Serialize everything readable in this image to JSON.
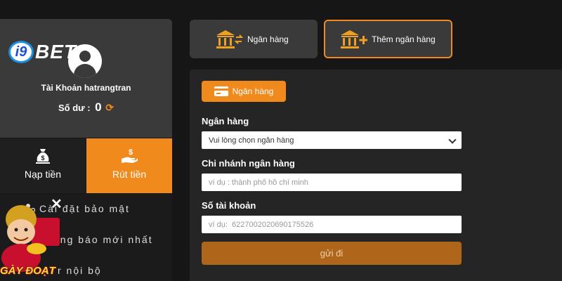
{
  "brand": {
    "logo_i9": "i9",
    "logo_bet": "BET"
  },
  "account": {
    "name": "Tài Khoản hatrangtran",
    "balance_label": "Số dư :",
    "balance_value": "0",
    "refresh_icon": "refresh-icon"
  },
  "actions": {
    "deposit_label": "Nạp tiền",
    "withdraw_label": "Rút tiền"
  },
  "menu": {
    "items": [
      "Cài đặt bảo mật",
      "ông báo mới nhất",
      "r nội bộ"
    ]
  },
  "promo": {
    "text": "GÀY ĐOẠT"
  },
  "tabs": {
    "bank_label": "Ngân hàng",
    "add_bank_label": "Thêm ngân hàng"
  },
  "form": {
    "chip_label": "Ngân hàng",
    "bank_label": "Ngân hàng",
    "bank_select_value": "Vui lòng chọn ngân hàng",
    "branch_label": "Chi nhánh ngân hàng",
    "branch_placeholder": "ví dụ : thành phố hồ chí minh",
    "account_label": "Số tài khoản",
    "account_placeholder": "ví dụ:  6227002020690175526",
    "submit_label": "gửi đi"
  },
  "colors": {
    "accent": "#f08a1c",
    "panel": "#3a3a3a",
    "background": "#161616"
  }
}
